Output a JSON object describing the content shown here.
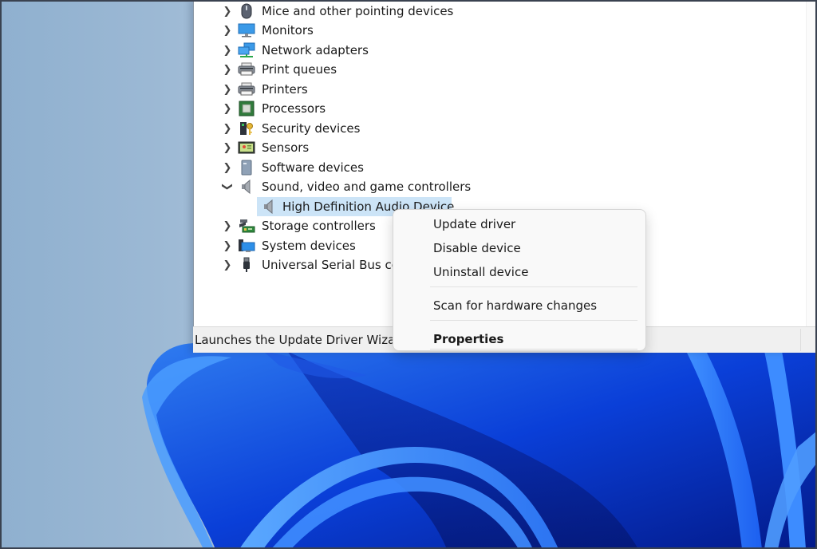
{
  "device_manager": {
    "tree": [
      {
        "label": "Mice and other pointing devices",
        "icon": "mouse-icon",
        "expanded": false
      },
      {
        "label": "Monitors",
        "icon": "monitor-icon",
        "expanded": false
      },
      {
        "label": "Network adapters",
        "icon": "network-adapter-icon",
        "expanded": false
      },
      {
        "label": "Print queues",
        "icon": "print-queue-icon",
        "expanded": false
      },
      {
        "label": "Printers",
        "icon": "printer-icon",
        "expanded": false
      },
      {
        "label": "Processors",
        "icon": "processor-icon",
        "expanded": false
      },
      {
        "label": "Security devices",
        "icon": "security-device-icon",
        "expanded": false
      },
      {
        "label": "Sensors",
        "icon": "sensor-icon",
        "expanded": false
      },
      {
        "label": "Software devices",
        "icon": "software-device-icon",
        "expanded": false
      },
      {
        "label": "Sound, video and game controllers",
        "icon": "speaker-icon",
        "expanded": true,
        "children": [
          {
            "label": "High Definition Audio Device",
            "icon": "speaker-icon",
            "selected": true
          }
        ]
      },
      {
        "label": "Storage controllers",
        "icon": "storage-controller-icon",
        "expanded": false
      },
      {
        "label": "System devices",
        "icon": "system-device-icon",
        "expanded": false
      },
      {
        "label": "Universal Serial Bus controllers",
        "icon": "usb-icon",
        "expanded": false
      }
    ],
    "status_text": "Launches the Update Driver Wizard for the selected device."
  },
  "context_menu": {
    "items": [
      {
        "label": "Update driver"
      },
      {
        "label": "Disable device"
      },
      {
        "label": "Uninstall device"
      },
      {
        "label": "Scan for hardware changes"
      },
      {
        "label": "Properties",
        "bold": true
      }
    ]
  },
  "colors": {
    "selection": "#cce4f7",
    "wallpaper_blue": "#1a4fe0"
  }
}
